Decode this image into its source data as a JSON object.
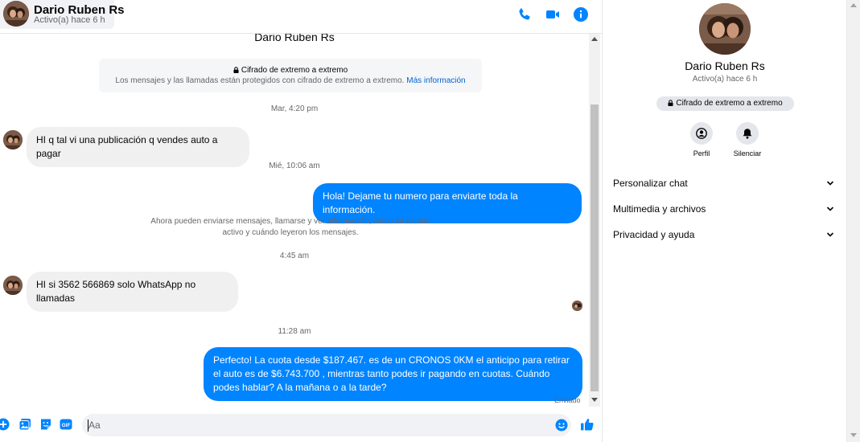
{
  "colors": {
    "accent": "#0084ff",
    "incoming_bubble": "#f0f0f0",
    "muted_text": "#65676b",
    "link": "#0064d1"
  },
  "header": {
    "contact_name": "Dario Ruben Rs",
    "contact_status": "Activo(a) hace 6 h",
    "icons": [
      "phone-icon",
      "video-camera-icon",
      "info-icon"
    ]
  },
  "conversation": {
    "top_name": "Dario Ruben Rs",
    "encryption_notice": {
      "title": "Cifrado de extremo a extremo",
      "description": "Los mensajes y las llamadas están protegidos con cifrado de extremo a extremo.",
      "link": "Más información"
    },
    "timestamps": [
      "Mar, 4:20 pm",
      "Mié, 10:06 am",
      "4:45 am",
      "11:28 am"
    ],
    "messages": [
      {
        "direction": "in",
        "text": "HI q tal vi una publicación q vendes auto a pagar"
      },
      {
        "direction": "out",
        "text": "Hola! Dejame tu numero  para enviarte toda la información."
      },
      {
        "direction": "in",
        "text": "HI si 3562 566869 solo WhatsApp no llamadas"
      },
      {
        "direction": "out",
        "text": "Perfecto! La cuota desde $187.467. es de un CRONOS 0KM el anticipo para retirar el auto es de $6.743.700 , mientras tanto podes ir pagando en cuotas. Cuándo podes hablar? A la mañana o a la tarde?"
      }
    ],
    "system_note": "Ahora pueden enviarse mensajes, llamarse y ver información, como su estado activo y cuándo leyeron los mensajes.",
    "sent_status": "Enviado"
  },
  "composer": {
    "placeholder": "Aa",
    "icons": [
      "plus-icon",
      "image-icon",
      "sticker-icon",
      "gif-icon",
      "emoji-icon",
      "like-icon"
    ],
    "gif_label": "GIF"
  },
  "info_panel": {
    "name": "Dario Ruben Rs",
    "status": "Activo(a) hace 6 h",
    "encryption_badge": "Cifrado de extremo a extremo",
    "actions": [
      {
        "label": "Perfil",
        "icon": "profile-icon"
      },
      {
        "label": "Silenciar",
        "icon": "bell-icon"
      }
    ],
    "sections": [
      {
        "label": "Personalizar chat"
      },
      {
        "label": "Multimedia y archivos"
      },
      {
        "label": "Privacidad y ayuda"
      }
    ]
  }
}
